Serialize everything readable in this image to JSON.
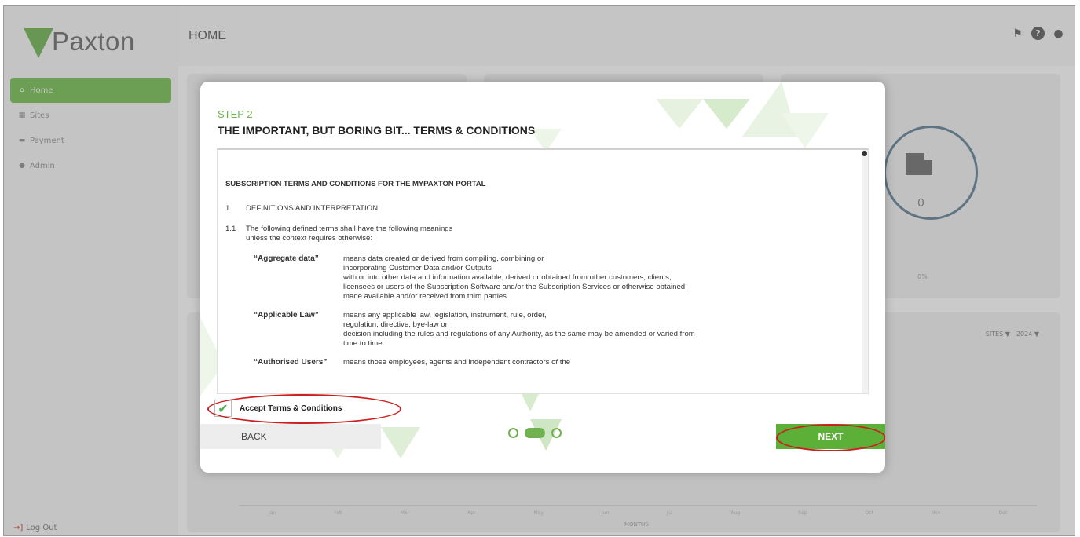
{
  "brand": {
    "name": "Paxton",
    "accent": "#6fb24f"
  },
  "sidebar": {
    "items": [
      {
        "label": "Home",
        "icon": "home-icon",
        "active": true
      },
      {
        "label": "Sites",
        "icon": "building-icon",
        "active": false
      },
      {
        "label": "Payment",
        "icon": "card-icon",
        "active": false
      },
      {
        "label": "Admin",
        "icon": "user-icon",
        "active": false
      }
    ],
    "logout": "Log Out"
  },
  "header": {
    "title": "HOME",
    "icons": [
      "bell-icon",
      "help-icon",
      "user-icon"
    ]
  },
  "background": {
    "ring_value": "0",
    "ring_percent": "0%",
    "filters": {
      "type": "SITES",
      "year": "2024"
    },
    "months": [
      "Jan",
      "Feb",
      "Mar",
      "Apr",
      "May",
      "Jun",
      "Jul",
      "Aug",
      "Sep",
      "Oct",
      "Nov",
      "Dec"
    ],
    "months_label": "MONTHS"
  },
  "modal": {
    "step": "STEP 2",
    "title": "THE IMPORTANT, BUT BORING BIT... TERMS & CONDITIONS",
    "terms": {
      "heading": "SUBSCRIPTION TERMS AND CONDITIONS FOR THE MYPAXTON PORTAL",
      "section_num": "1",
      "section_title": "DEFINITIONS AND INTERPRETATION",
      "clause_num": "1.1",
      "clause_line1": "The following defined terms shall have the following meanings",
      "clause_line2": "unless the context requires otherwise:",
      "definitions": [
        {
          "term": "“Aggregate data”",
          "lines": [
            "means data created or derived from compiling, combining or",
            "incorporating Customer Data and/or Outputs",
            "with or into other data and information available, derived or obtained from other customers, clients,",
            "licensees or users of the Subscription Software and/or the Subscription Services or otherwise obtained,",
            "made available and/or received from third parties."
          ]
        },
        {
          "term": "“Applicable Law”",
          "lines": [
            "means any applicable law, legislation, instrument, rule, order,",
            "regulation, directive, bye-law or",
            "decision including the rules and regulations of any Authority, as the same may be amended or varied from",
            "time to time."
          ]
        },
        {
          "term": "“Authorised Users”",
          "lines": [
            "means those employees, agents and independent contractors of the"
          ]
        }
      ]
    },
    "accept_label": "Accept Terms & Conditions",
    "accept_checked": true,
    "back_label": "BACK",
    "next_label": "NEXT",
    "steps_total": 3,
    "current_step": 2
  }
}
